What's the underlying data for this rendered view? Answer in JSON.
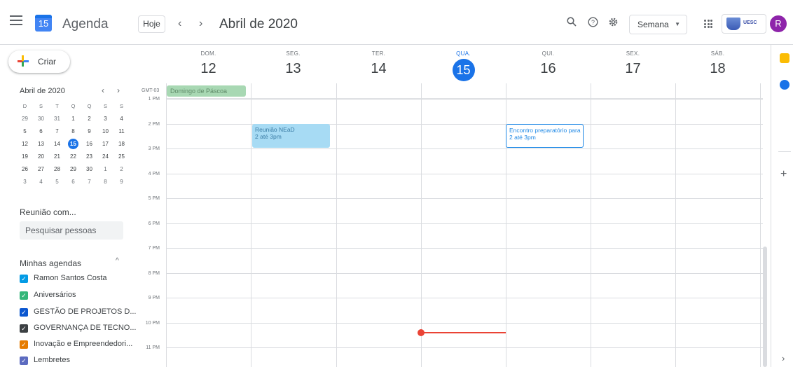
{
  "header": {
    "app_name": "Agenda",
    "logo_day": "15",
    "today_label": "Hoje",
    "prev_label": "‹",
    "next_label": "›",
    "month_title": "Abril de 2020",
    "view_label": "Semana",
    "org_label": "UESC",
    "avatar_letter": "R"
  },
  "sidebar": {
    "create_label": "Criar",
    "mini_calendar": {
      "title": "Abril de 2020",
      "weekday_headers": [
        "D",
        "S",
        "T",
        "Q",
        "Q",
        "S",
        "S"
      ],
      "weeks": [
        [
          "29",
          "30",
          "31",
          "1",
          "2",
          "3",
          "4"
        ],
        [
          "5",
          "6",
          "7",
          "8",
          "9",
          "10",
          "11"
        ],
        [
          "12",
          "13",
          "14",
          "15",
          "16",
          "17",
          "18"
        ],
        [
          "19",
          "20",
          "21",
          "22",
          "23",
          "24",
          "25"
        ],
        [
          "26",
          "27",
          "28",
          "29",
          "30",
          "1",
          "2"
        ],
        [
          "3",
          "4",
          "5",
          "6",
          "7",
          "8",
          "9"
        ]
      ],
      "today": "15"
    },
    "meet_title": "Reunião com...",
    "search_placeholder": "Pesquisar pessoas",
    "my_calendars_title": "Minhas agendas",
    "calendars": [
      {
        "label": "Ramon Santos Costa",
        "color": "#039be5"
      },
      {
        "label": "Aniversários",
        "color": "#33b679"
      },
      {
        "label": "GESTÃO DE PROJETOS D...",
        "color": "#0b57d0"
      },
      {
        "label": "GOVERNANÇA DE TECNO...",
        "color": "#3c4043"
      },
      {
        "label": "Inovação e Empreendedori...",
        "color": "#e67c00"
      },
      {
        "label": "Lembretes",
        "color": "#5c6bc0"
      }
    ]
  },
  "week": {
    "timezone": "GMT-03",
    "days": [
      {
        "name": "DOM.",
        "num": "12"
      },
      {
        "name": "SEG.",
        "num": "13"
      },
      {
        "name": "TER.",
        "num": "14"
      },
      {
        "name": "QUA.",
        "num": "15",
        "today": true
      },
      {
        "name": "QUI.",
        "num": "16"
      },
      {
        "name": "SEX.",
        "num": "17"
      },
      {
        "name": "SÁB.",
        "num": "18"
      }
    ],
    "hours": [
      "1 PM",
      "2 PM",
      "3 PM",
      "4 PM",
      "5 PM",
      "6 PM",
      "7 PM",
      "8 PM",
      "9 PM",
      "10 PM",
      "11 PM"
    ],
    "all_day_event": "Domingo de Páscoa",
    "events": [
      {
        "title": "Reunião NEaD",
        "time": "2 até 3pm",
        "day": "13",
        "style": "filled"
      },
      {
        "title": "Encontro preparatório para",
        "time": "2 até 3pm",
        "day": "16",
        "style": "outline"
      }
    ]
  },
  "colors": {
    "accent": "#1a73e8",
    "now_line": "#ea4335",
    "allday_bg": "#a8d8b3",
    "event_filled_bg": "#a7dbf4"
  }
}
